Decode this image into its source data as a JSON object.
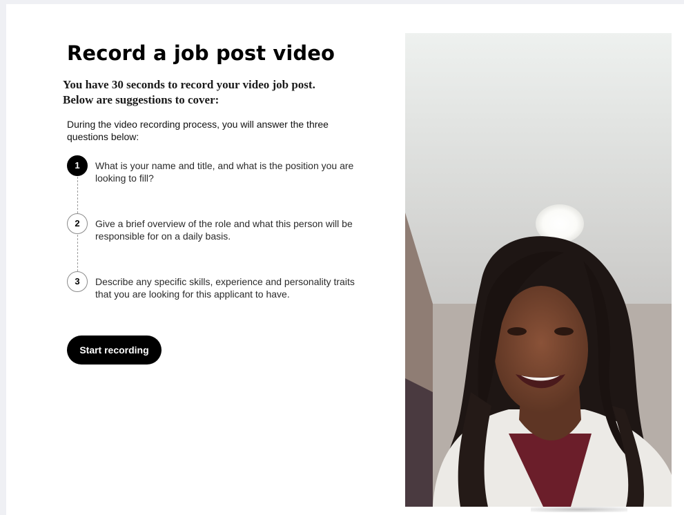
{
  "page": {
    "title": "Record a job post video",
    "subtitle_line1": "You have 30 seconds to record your video job post.",
    "subtitle_line2": "Below are suggestions to cover:",
    "intro": "During the video recording process, you will answer the three questions below:"
  },
  "steps": [
    {
      "number": "1",
      "text": "What is your name and title, and what is the position you are looking to fill?",
      "active": true
    },
    {
      "number": "2",
      "text": "Give a brief overview of the role and what this person will be responsible for on a daily basis.",
      "active": false
    },
    {
      "number": "3",
      "text": "Describe any specific skills, experience and personality traits that you are looking for this applicant to have.",
      "active": false
    }
  ],
  "actions": {
    "start_label": "Start recording"
  },
  "colors": {
    "primary": "#000000",
    "background": "#ffffff",
    "outer_background": "#eff0f4"
  }
}
